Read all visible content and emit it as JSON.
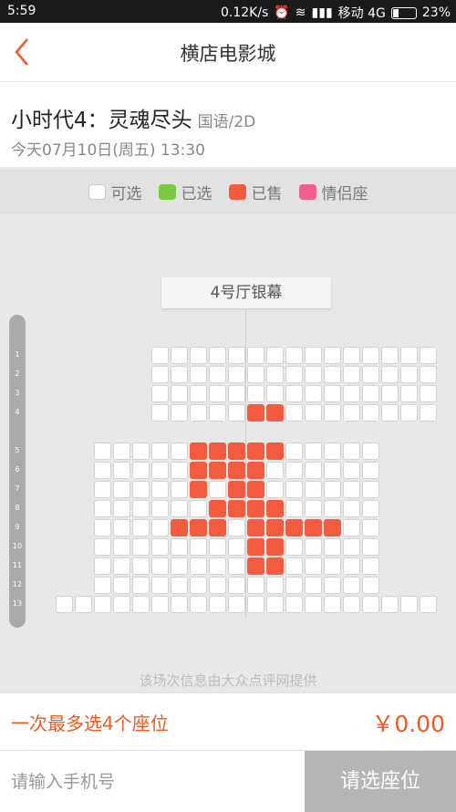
{
  "status_bar": {
    "time": "5:59",
    "net_speed": "0.12K/s",
    "carrier": "移动 4G",
    "battery": "23%"
  },
  "header": {
    "title": "横店电影城"
  },
  "movie": {
    "title": "小时代4：灵魂尽头",
    "format": "国语/2D",
    "showtime": "今天07月10日(周五) 13:30"
  },
  "legend": [
    {
      "label": "可选",
      "type": "avail"
    },
    {
      "label": "已选",
      "type": "sel"
    },
    {
      "label": "已售",
      "type": "sold"
    },
    {
      "label": "情侣座",
      "type": "couple"
    }
  ],
  "hall": {
    "screen_label": "4号厅银幕",
    "row_labels": [
      "1",
      "2",
      "3",
      "4",
      "5",
      "6",
      "7",
      "8",
      "9",
      "10",
      "11",
      "12",
      "13"
    ],
    "rows": [
      {
        "seats": 15,
        "sold": []
      },
      {
        "seats": 15,
        "sold": []
      },
      {
        "seats": 15,
        "sold": []
      },
      {
        "seats": 15,
        "sold": [
          5,
          6
        ]
      },
      {
        "seats": 15,
        "sold": [
          5,
          6,
          7,
          8,
          9
        ]
      },
      {
        "seats": 15,
        "sold": [
          5,
          6,
          7,
          8
        ]
      },
      {
        "seats": 15,
        "sold": [
          5,
          7,
          8
        ]
      },
      {
        "seats": 15,
        "sold": [
          6,
          7,
          8,
          9
        ]
      },
      {
        "seats": 15,
        "sold": [
          4,
          5,
          6,
          8,
          9,
          10,
          11,
          12
        ]
      },
      {
        "seats": 15,
        "sold": [
          8,
          9
        ]
      },
      {
        "seats": 15,
        "sold": [
          8,
          9
        ]
      },
      {
        "seats": 15,
        "sold": []
      },
      {
        "seats": 20,
        "sold": []
      }
    ]
  },
  "source_note": "该场次信息由大众点评网提供",
  "limit_message": "一次最多选4个座位",
  "price": "￥0.00",
  "phone_input": {
    "placeholder": "请输入手机号",
    "value": ""
  },
  "submit_label": "请选座位",
  "colors": {
    "accent": "#f05a22",
    "sold": "#f25b3e",
    "selected": "#7ac943",
    "couple": "#f0608e"
  }
}
